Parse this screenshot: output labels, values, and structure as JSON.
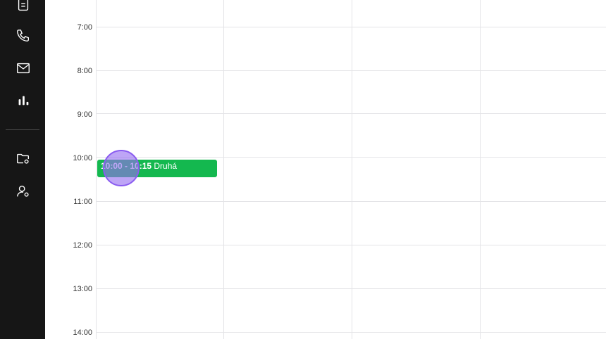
{
  "sidebar": {
    "icons": [
      "document-icon",
      "phone-icon",
      "mail-icon",
      "bar-chart-icon",
      "folder-settings-icon",
      "user-settings-icon"
    ]
  },
  "calendar": {
    "hours": [
      "7:00",
      "8:00",
      "9:00",
      "10:00",
      "11:00",
      "12:00",
      "13:00",
      "14:00"
    ],
    "event": {
      "time": "10:00 - 10:15",
      "title": "Druhá",
      "color": "#14b84f"
    }
  },
  "colors": {
    "sidebar": "#161616",
    "grid": "#e4e4e7",
    "cursor": "#966ef0"
  }
}
